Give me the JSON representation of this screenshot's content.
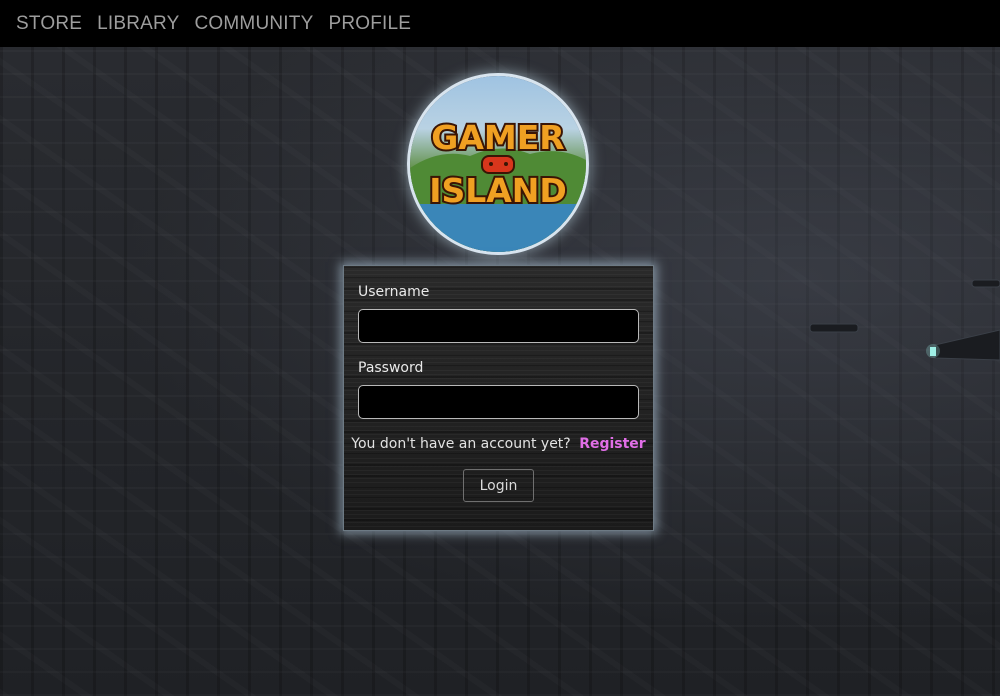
{
  "nav": {
    "items": [
      "STORE",
      "LIBRARY",
      "COMMUNITY",
      "PROFILE"
    ]
  },
  "logo": {
    "line1": "GAMER",
    "line2": "ISLAND"
  },
  "login": {
    "username_label": "Username",
    "username_value": "",
    "password_label": "Password",
    "password_value": "",
    "no_account_text": "You don't have an account yet?",
    "register_link": "Register",
    "login_button": "Login"
  },
  "colors": {
    "nav_bg": "#000000",
    "nav_text": "#9d9d9d",
    "register_accent": "#e06ee6",
    "panel_glow": "#bed7eb"
  }
}
